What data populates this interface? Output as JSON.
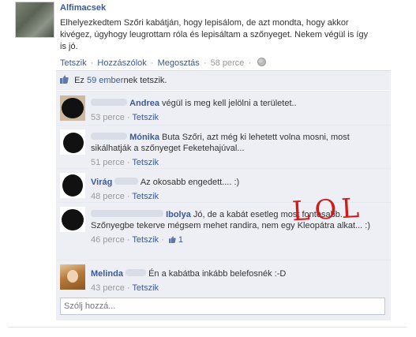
{
  "post": {
    "author": "Alfimacsek",
    "text": "Elhelyezkedtem Szőri kabátján, hogy lepisálom, de azt mondta, hogy akkor kivégez, úgyhogy leugrottam róla és lepisáltam a szőnyeget. Nekem végül is így is jó.",
    "actions": {
      "like": "Tetszik",
      "comment": "Hozzászólok",
      "share": "Megosztás",
      "time": "58 perce"
    }
  },
  "likes": {
    "prefix": "Ez",
    "count_link": "59 ember",
    "suffix": "nek tetszik."
  },
  "comments": [
    {
      "name": "Andrea",
      "text": "végül is meg kell jelölni a területet..",
      "time": "53 perce",
      "like": "Tetszik",
      "like_count": ""
    },
    {
      "name": "Mónika",
      "text": "Buta Szőri, azt még ki lehetett volna mosni, most sikálhatják a szőnyeget Feketehajúval...",
      "time": "51 perce",
      "like": "Tetszik",
      "like_count": ""
    },
    {
      "name": "Virág",
      "text": "Az okosabb engedett.... :)",
      "time": "48 perce",
      "like": "Tetszik",
      "like_count": ""
    },
    {
      "name": "Ibolya",
      "text": "Jó, de a kabát esetleg most fontosabb. Szőnyegbe tekerve mégsem mehet randira, nem egy Kleopátra alkat... :)",
      "time": "46 perce",
      "like": "Tetszik",
      "like_count": "1"
    },
    {
      "name": "Melinda",
      "text": "Én a kabátba inkább belefosnék :-D",
      "time": "43 perce",
      "like": "Tetszik",
      "like_count": ""
    }
  ],
  "reply": {
    "placeholder": "Szólj hozzá..."
  },
  "annotation": {
    "text": "LOL"
  },
  "colors": {
    "link": "#3b5998",
    "feedback_bg": "#edeff4",
    "annotation": "#d21a1a"
  }
}
